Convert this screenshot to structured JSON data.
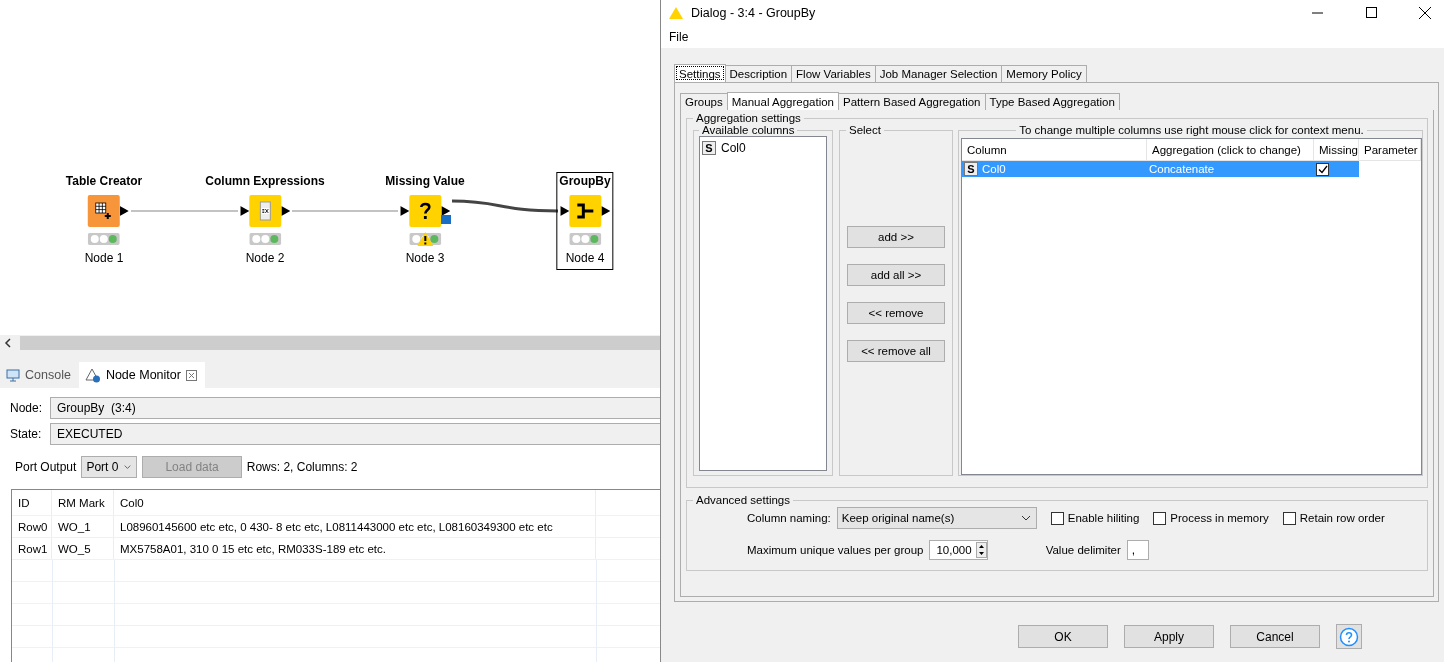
{
  "canvas": {
    "nodes": [
      {
        "kind": "table-creator",
        "title": "Table Creator",
        "label": "Node 1",
        "executed": true,
        "warning": false,
        "selected": false
      },
      {
        "kind": "expression",
        "title": "Column Expressions",
        "label": "Node 2",
        "executed": true,
        "warning": false,
        "selected": false
      },
      {
        "kind": "missing-value",
        "title": "Missing Value",
        "label": "Node 3",
        "executed": true,
        "warning": true,
        "selected": false
      },
      {
        "kind": "groupby",
        "title": "GroupBy",
        "label": "Node 4",
        "executed": true,
        "warning": false,
        "selected": true
      }
    ]
  },
  "monitor": {
    "tabs": [
      {
        "kind": "console",
        "label": "Console",
        "selected": false
      },
      {
        "kind": "monitor",
        "label": "Node Monitor",
        "selected": true
      }
    ],
    "node_label": "Node:",
    "node_value": "GroupBy  (3:4)",
    "state_label": "State:",
    "state_value": "EXECUTED",
    "port_label": "Port Output",
    "port_select": "Port 0",
    "load_button": {
      "label": "Load data",
      "disabled": true
    },
    "summary": "Rows: 2, Columns: 2",
    "table": {
      "columns": [
        "ID",
        "RM Mark",
        "Col0"
      ],
      "rows": [
        [
          "Row0",
          "WO_1",
          "L08960145600 etc etc, 0 430- 8 etc etc, L0811443000 etc etc, L08160349300 etc etc"
        ],
        [
          "Row1",
          "WO_5",
          "MX5758A01, 310 0 15 etc etc, RM033S-189 etc etc."
        ]
      ]
    }
  },
  "dialog": {
    "title": "Dialog - 3:4 - GroupBy",
    "menu": [
      "File"
    ],
    "tabs": [
      {
        "label": "Settings",
        "selected": true
      },
      {
        "label": "Description",
        "selected": false
      },
      {
        "label": "Flow Variables",
        "selected": false
      },
      {
        "label": "Job Manager Selection",
        "selected": false
      },
      {
        "label": "Memory Policy",
        "selected": false
      }
    ],
    "subtabs": [
      {
        "label": "Groups",
        "selected": false
      },
      {
        "label": "Manual Aggregation",
        "selected": true
      },
      {
        "label": "Pattern Based Aggregation",
        "selected": false
      },
      {
        "label": "Type Based Aggregation",
        "selected": false
      }
    ],
    "aggregation": {
      "legend": "Aggregation settings",
      "available": {
        "legend": "Available columns",
        "items": [
          {
            "type": "S",
            "name": "Col0"
          }
        ]
      },
      "select": {
        "legend": "Select",
        "buttons": [
          "add >>",
          "add all >>",
          "<< remove",
          "<< remove all"
        ]
      },
      "columns": {
        "legend": "To change multiple columns use right mouse click for context menu.",
        "headers": [
          "Column",
          "Aggregation (click to change)",
          "Missing",
          "Parameter"
        ],
        "rows": [
          {
            "type": "S",
            "column": "Col0",
            "aggregation": "Concatenate",
            "missing": true,
            "selected": true
          }
        ]
      }
    },
    "advanced": {
      "legend": "Advanced settings",
      "naming_label": "Column naming:",
      "naming_value": "Keep original name(s)",
      "checkboxes": [
        {
          "label": "Enable hiliting",
          "checked": false
        },
        {
          "label": "Process in memory",
          "checked": false
        },
        {
          "label": "Retain row order",
          "checked": false
        }
      ],
      "max_label": "Maximum unique values per group",
      "max_value": "10,000",
      "delimiter_label": "Value delimiter",
      "delimiter_value": ","
    },
    "buttons": [
      "OK",
      "Apply",
      "Cancel"
    ]
  }
}
